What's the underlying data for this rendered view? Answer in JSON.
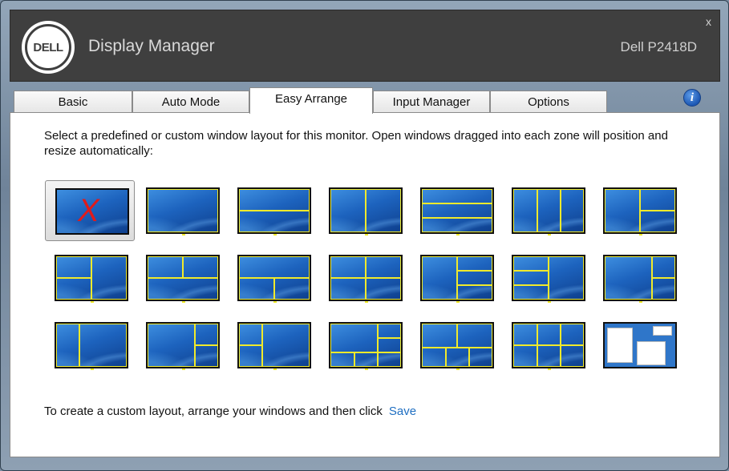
{
  "window": {
    "close_label": "x"
  },
  "header": {
    "logo_text": "DELL",
    "app_title": "Display Manager",
    "monitor_model": "Dell P2418D"
  },
  "tabs": [
    {
      "label": "Basic",
      "active": false
    },
    {
      "label": "Auto Mode",
      "active": false
    },
    {
      "label": "Easy Arrange",
      "active": true
    },
    {
      "label": "Input Manager",
      "active": false
    },
    {
      "label": "Options",
      "active": false
    }
  ],
  "info_icon": {
    "glyph": "i",
    "icon": "info-icon"
  },
  "content": {
    "description": "Select a predefined or custom window layout for this monitor.  Open windows dragged into each zone will position and resize automatically:",
    "footer_text": "To create a custom layout, arrange your windows and then click",
    "save_link": "Save"
  },
  "layouts": {
    "selected_index": 0,
    "none_mark": "X",
    "zone_color": "#f0ea2b",
    "items": [
      "none",
      "full",
      "2-rows",
      "2-cols",
      "3-rows",
      "3-cols",
      "left-half-right-2",
      "left-2-right-half",
      "2x2-alt-a",
      "2x2-alt-b",
      "2x2",
      "left-half-right-3",
      "left-3-right-half",
      "right-third-split",
      "2-cols-wide-left",
      "left-wide-right-2",
      "left-2-right-wide",
      "top-wide-bottom-3",
      "top-2-bottom-3",
      "2x3",
      "custom"
    ]
  }
}
